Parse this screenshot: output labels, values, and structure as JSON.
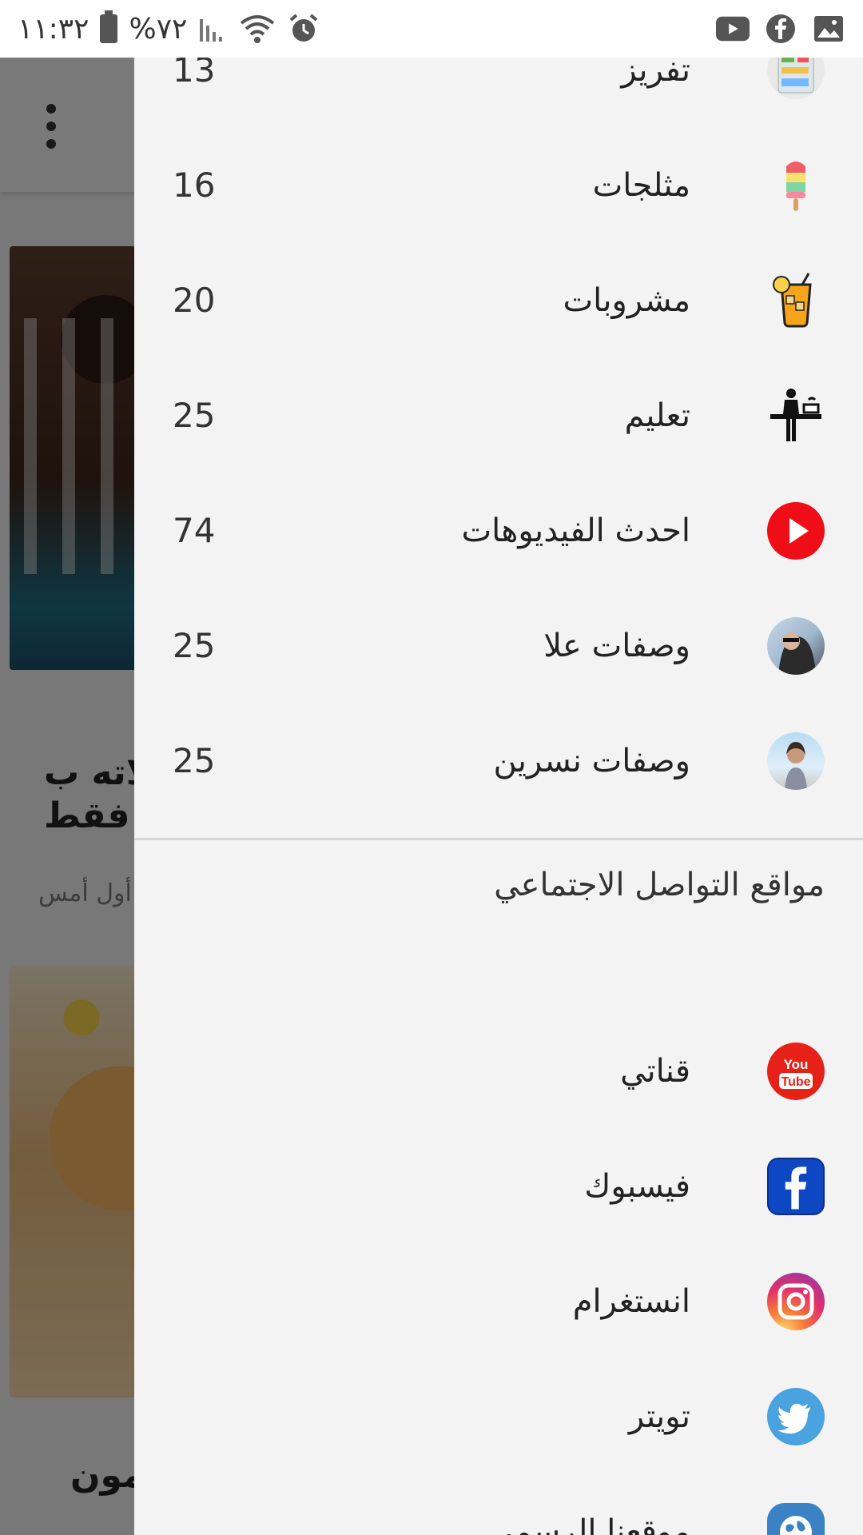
{
  "status_bar": {
    "time": "١١:٣٢",
    "battery": "%٧٢",
    "right_icons": [
      "youtube-icon",
      "facebook-icon",
      "image-icon"
    ]
  },
  "background": {
    "card_title_line1": "لاته ب",
    "card_title_line2": "فقط",
    "card_date": "أول أمس",
    "card2_title": "مون"
  },
  "drawer": {
    "categories": [
      {
        "label": "تفريز",
        "count": "13",
        "icon": "fridge-icon"
      },
      {
        "label": "مثلجات",
        "count": "16",
        "icon": "popsicle-icon"
      },
      {
        "label": "مشروبات",
        "count": "20",
        "icon": "juice-icon"
      },
      {
        "label": "تعليم",
        "count": "25",
        "icon": "teacher-icon"
      },
      {
        "label": "احدث الفيديوهات",
        "count": "74",
        "icon": "play-icon"
      },
      {
        "label": "وصفات علا",
        "count": "25",
        "icon": "avatar-ola-icon"
      },
      {
        "label": "وصفات نسرين",
        "count": "25",
        "icon": "avatar-nesreen-icon"
      }
    ],
    "social_section_title": "مواقع التواصل الاجتماعي",
    "social": [
      {
        "label": "قناتي",
        "icon": "youtube-icon",
        "color": "#e62117"
      },
      {
        "label": "فيسبوك",
        "icon": "facebook-icon",
        "color": "#0d47c4"
      },
      {
        "label": "انستغرام",
        "icon": "instagram-icon",
        "color": "#c13584"
      },
      {
        "label": "تويتر",
        "icon": "twitter-icon",
        "color": "#4aa3df"
      },
      {
        "label": "موقعنا الرسمي",
        "icon": "globe-icon",
        "color": "#3b82c4"
      }
    ]
  }
}
